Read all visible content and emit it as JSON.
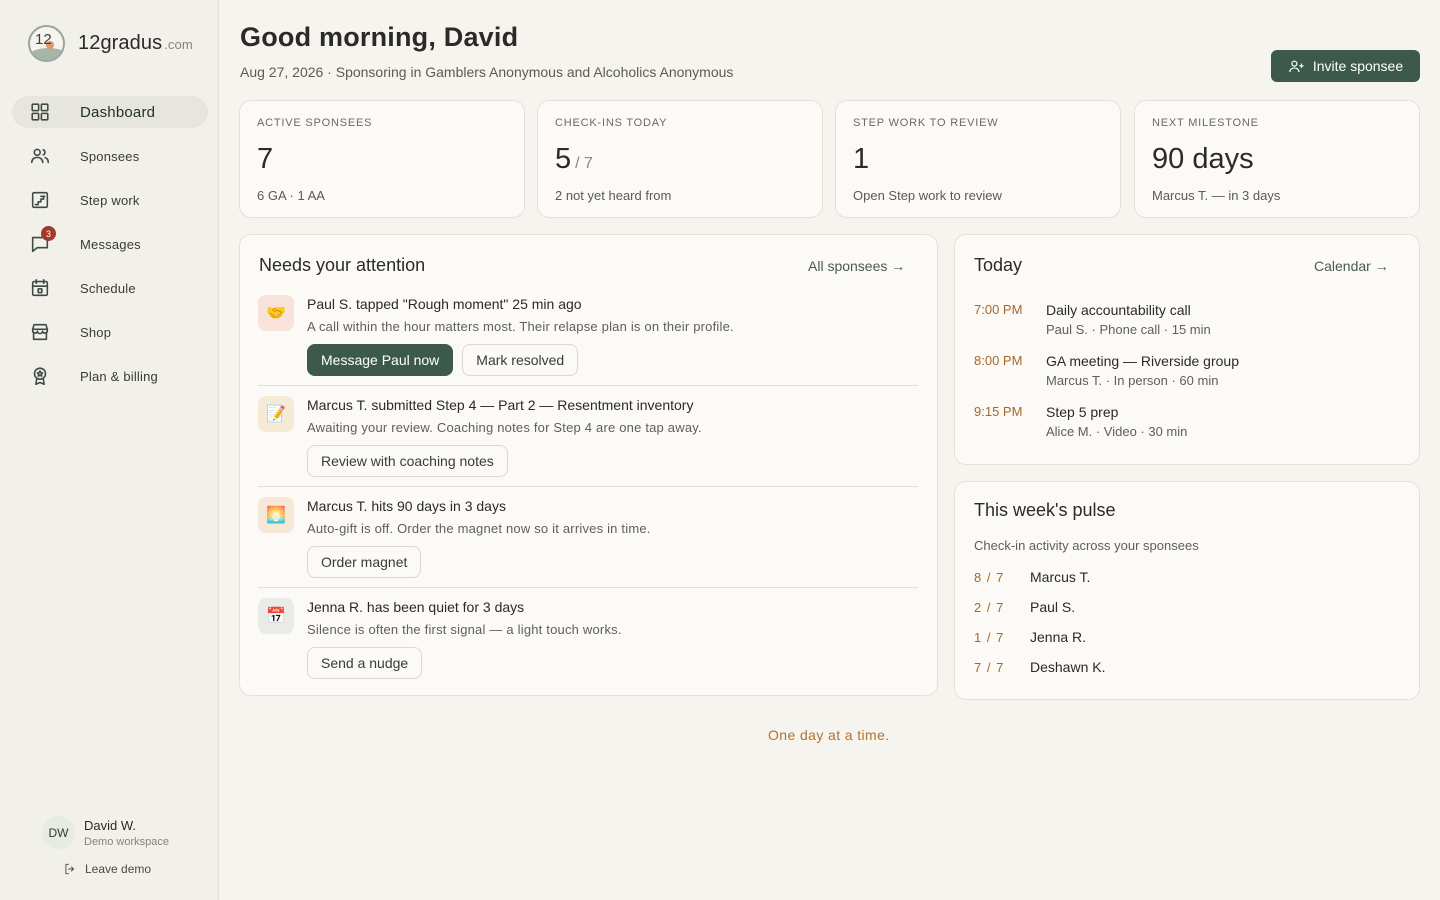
{
  "brand": {
    "name": "12gradus",
    "tld": ".com",
    "logo_text": "12"
  },
  "nav": {
    "items": [
      {
        "label": "Dashboard",
        "icon": "grid-icon"
      },
      {
        "label": "Sponsees",
        "icon": "people-icon"
      },
      {
        "label": "Step work",
        "icon": "stairs-icon"
      },
      {
        "label": "Messages",
        "icon": "chat-icon",
        "badge": "3"
      },
      {
        "label": "Schedule",
        "icon": "calendar-icon"
      },
      {
        "label": "Shop",
        "icon": "store-icon"
      },
      {
        "label": "Plan & billing",
        "icon": "award-icon"
      }
    ]
  },
  "user": {
    "initials": "DW",
    "name": "David W.",
    "workspace": "Demo workspace",
    "leave_label": "Leave demo"
  },
  "header": {
    "greeting": "Good morning, David",
    "subline": "Aug 27, 2026 · Sponsoring in Gamblers Anonymous and Alcoholics Anonymous",
    "invite_label": "Invite sponsee"
  },
  "stats": [
    {
      "label": "ACTIVE SPONSEES",
      "value": "7",
      "of": "",
      "sub": "6 GA · 1 AA"
    },
    {
      "label": "CHECK-INS TODAY",
      "value": "5",
      "of": "/ 7",
      "sub": "2 not yet heard from"
    },
    {
      "label": "STEP WORK TO REVIEW",
      "value": "1",
      "of": "",
      "sub": "Open Step work to review"
    },
    {
      "label": "NEXT MILESTONE",
      "value": "90 days",
      "of": "",
      "sub": "Marcus T. — in 3 days"
    }
  ],
  "attention": {
    "title": "Needs your attention",
    "link": "All sponsees →",
    "items": [
      {
        "icon": "🤝",
        "title": "Paul S. tapped \"Rough moment\" 25 min ago",
        "desc": "A call within the hour matters most. Their relapse plan is on their profile.",
        "actions": [
          "Message Paul now",
          "Mark resolved"
        ]
      },
      {
        "icon": "📝",
        "title": "Marcus T. submitted Step 4 — Part 2 — Resentment inventory",
        "desc": "Awaiting your review. Coaching notes for Step 4 are one tap away.",
        "actions": [
          "Review with coaching notes"
        ]
      },
      {
        "icon": "🌅",
        "title": "Marcus T. hits 90 days in 3 days",
        "desc": "Auto-gift is off. Order the magnet now so it arrives in time.",
        "actions": [
          "Order magnet"
        ]
      },
      {
        "icon": "📅",
        "title": "Jenna R. has been quiet for 3 days",
        "desc": "Silence is often the first signal — a light touch works.",
        "actions": [
          "Send a nudge"
        ]
      }
    ]
  },
  "today": {
    "title": "Today",
    "link": "Calendar →",
    "events": [
      {
        "time": "7:00 PM",
        "title": "Daily accountability call",
        "meta": "Paul S. · Phone call · 15 min"
      },
      {
        "time": "8:00 PM",
        "title": "GA meeting — Riverside group",
        "meta": "Marcus T. · In person · 60 min"
      },
      {
        "time": "9:15 PM",
        "title": "Step 5 prep",
        "meta": "Alice M. · Video · 30 min"
      }
    ]
  },
  "pulse": {
    "title": "This week's pulse",
    "subtitle": "Check-in activity across your sponsees",
    "rows": [
      {
        "count": "8 / 7",
        "name": "Marcus T."
      },
      {
        "count": "2 / 7",
        "name": "Paul S."
      },
      {
        "count": "1 / 7",
        "name": "Jenna R."
      },
      {
        "count": "7 / 7",
        "name": "Deshawn K."
      }
    ]
  },
  "footer": {
    "quote": "One day at a time."
  },
  "colors": {
    "accent": "#3b5a4b",
    "warm": "#a7672a",
    "badge": "#a13a2a",
    "background": "#f6f4ef"
  }
}
